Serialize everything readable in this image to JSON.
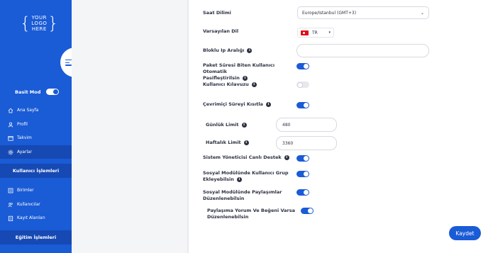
{
  "logo": {
    "line1": "YOUR",
    "line2": "LOGO",
    "line3": "HERE"
  },
  "sidebar": {
    "mode_label": "Basit Mod",
    "mode_on": true,
    "items": [
      {
        "label": "Ana Sayfa",
        "icon": "home-icon"
      },
      {
        "label": "Profil",
        "icon": "user-icon"
      },
      {
        "label": "Takvim",
        "icon": "calendar-icon"
      },
      {
        "label": "Ayarlar",
        "icon": "gear-icon",
        "active": true
      }
    ],
    "section1": "Kullanıcı İşlemleri",
    "items2": [
      {
        "label": "Birimler",
        "icon": "list-icon"
      },
      {
        "label": "Kullanıcılar",
        "icon": "users-icon"
      },
      {
        "label": "Kayıt Alanları",
        "icon": "clipboard-icon"
      }
    ],
    "section2": "Eğitim İşlemleri"
  },
  "settings": {
    "timezone_label": "Saat Dilimi",
    "timezone_value": "Europe/Istanbul (GMT+3)",
    "language_label": "Varsayılan Dil",
    "language_value": "TR",
    "ip_block_label": "Bloklu Ip Aralığı",
    "ip_block_value": "",
    "passive_label_1": "Paket Süresi Biten Kullanıcı Otomatik",
    "passive_label_2": "Pasifleştirilsin",
    "passive_on": true,
    "guide_label": "Kullanıcı Kılavuzu",
    "guide_on": false,
    "online_limit_label": "Çevrimiçi Süreyi Kısıtla",
    "online_limit_on": true,
    "daily_limit_label": "Günlük Limit",
    "daily_limit_value": "480",
    "weekly_limit_label": "Haftalık Limit",
    "weekly_limit_value": "3360",
    "admin_support_label": "Sistem Yöneticisi Canlı Destek",
    "admin_support_on": true,
    "social_group_label_1": "Sosyal Modülünde Kullanıcı Grup",
    "social_group_label_2": "Ekleyebilsin",
    "social_group_on": true,
    "social_share_label_1": "Sosyal Modülünde Paylaşımlar",
    "social_share_label_2": "Düzenlenebilsin",
    "social_share_on": true,
    "comment_label_1": "Paylaşıma Yorum Ve Beğeni Varsa",
    "comment_label_2": "Düzenlenebilsin",
    "comment_on": true
  },
  "save_label": "Kaydet"
}
